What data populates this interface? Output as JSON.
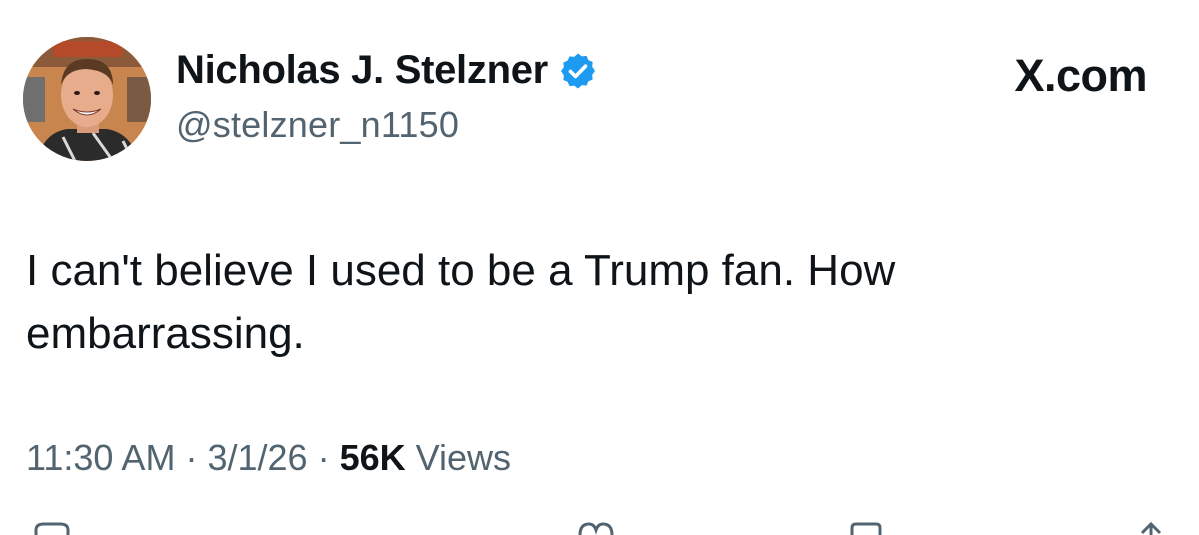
{
  "author": {
    "display_name": "Nicholas J. Stelzner",
    "handle": "@stelzner_n1150",
    "verified": true,
    "verified_color": "#1d9bf0",
    "avatar_icon": "profile-photo"
  },
  "brand": {
    "label": "X.com"
  },
  "tweet": {
    "text": "I can't believe I used to be a Trump fan. How embarrassing."
  },
  "meta": {
    "time": "11:30 AM",
    "separator": "·",
    "date": "3/1/26",
    "views_count": "56K",
    "views_label": "Views"
  },
  "actions": [
    {
      "icon": "reply-icon"
    },
    {
      "icon": "like-icon"
    },
    {
      "icon": "bookmark-icon"
    },
    {
      "icon": "share-icon"
    }
  ],
  "colors": {
    "text_primary": "#0f1419",
    "text_secondary": "#536471",
    "background": "#ffffff"
  }
}
